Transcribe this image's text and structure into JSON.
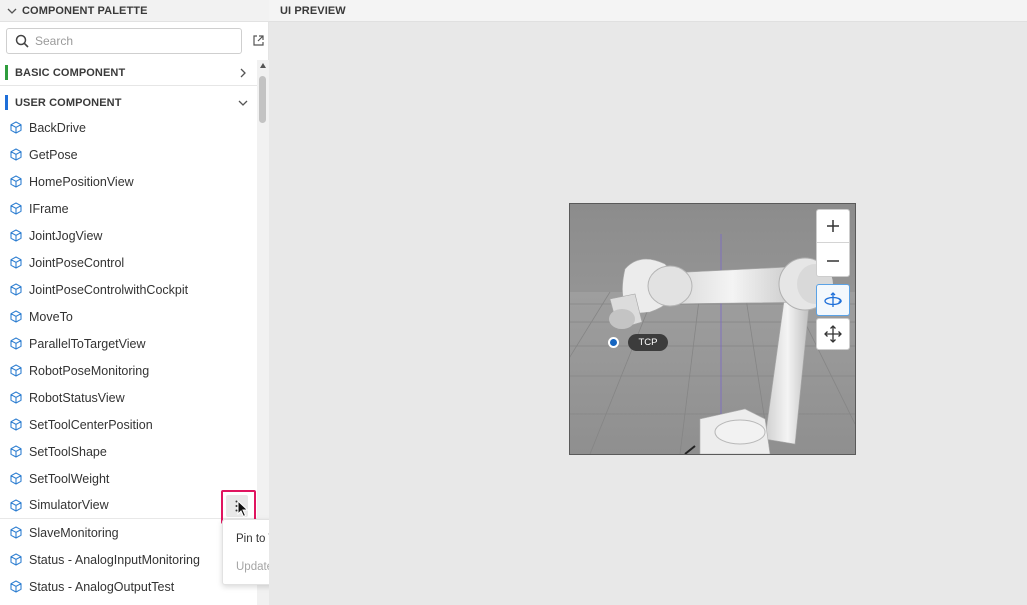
{
  "palette": {
    "title": "COMPONENT PALETTE",
    "search_placeholder": "Search",
    "sections": {
      "basic": {
        "label": "BASIC COMPONENT",
        "color": "#2e9d3d"
      },
      "user": {
        "label": "USER COMPONENT",
        "color": "#1e6fd9"
      }
    },
    "items": [
      "BackDrive",
      "GetPose",
      "HomePositionView",
      "IFrame",
      "JointJogView",
      "JointPoseControl",
      "JointPoseControlwithCockpit",
      "MoveTo",
      "ParallelToTargetView",
      "RobotPoseMonitoring",
      "RobotStatusView",
      "SetToolCenterPosition",
      "SetToolShape",
      "SetToolWeight",
      "SimulatorView",
      "SlaveMonitoring",
      "Status - AnalogInputMonitoring",
      "Status - AnalogOutputTest"
    ],
    "hovered_item": "SimulatorView",
    "context_menu": {
      "pin_label": "Pin to Top",
      "update_label": "Update"
    },
    "icons": {
      "item": "cube-icon",
      "search": "search-icon",
      "popout": "open-external-icon",
      "more": "more-vertical-icon"
    },
    "accent_color": "#1e6fd9",
    "highlight_color": "#e0145f"
  },
  "preview": {
    "title": "UI PREVIEW",
    "tcp_label": "TCP",
    "controls": [
      "zoom-in",
      "zoom-out",
      "rotate-view",
      "pan-view"
    ]
  }
}
